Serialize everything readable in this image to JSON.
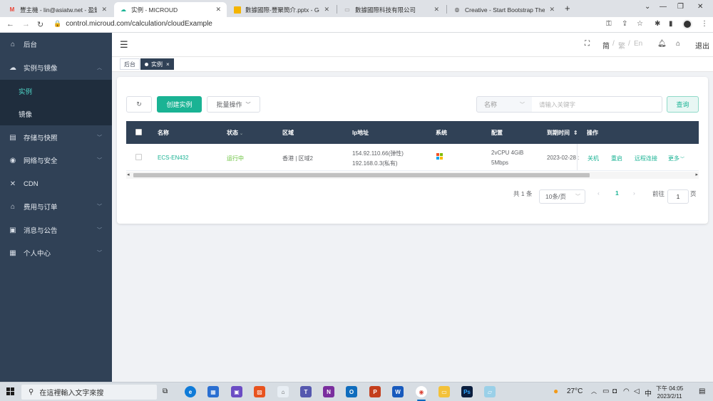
{
  "browser": {
    "tabs": [
      {
        "title": "豐主機 - lin@asiatw.net - 盈欽科",
        "icon": "gmail-icon"
      },
      {
        "title": "实例 - MICROUD",
        "icon": "cloud-icon"
      },
      {
        "title": "數據國際-豐聚簡介.pptx - Goo",
        "icon": "slides-icon"
      },
      {
        "title": "數據國際科技有限公司",
        "icon": "page-icon"
      },
      {
        "title": "Creative - Start Bootstrap Them",
        "icon": "globe-icon"
      }
    ],
    "url": "control.microud.com/calculation/cloudExample"
  },
  "sidebar": {
    "items": [
      {
        "label": "后台",
        "icon": "home-icon"
      },
      {
        "label": "实例与镜像",
        "icon": "cloud-icon"
      },
      {
        "label": "存储与快照",
        "icon": "storage-icon"
      },
      {
        "label": "网络与安全",
        "icon": "network-icon"
      },
      {
        "label": "CDN",
        "icon": "cdn-icon"
      },
      {
        "label": "费用与订单",
        "icon": "home-icon"
      },
      {
        "label": "消息与公告",
        "icon": "message-icon"
      },
      {
        "label": "个人中心",
        "icon": "grid-icon"
      }
    ],
    "submenu": [
      {
        "label": "实例"
      },
      {
        "label": "镜像"
      }
    ]
  },
  "header": {
    "lang_simplified": "简",
    "lang_traditional": "繁",
    "lang_english": "En",
    "logout": "退出",
    "separator": "/"
  },
  "tags": [
    {
      "label": "后台"
    },
    {
      "label": "实例"
    }
  ],
  "toolbar": {
    "create_label": "创建实例",
    "batch_label": "批量操作",
    "filter_field": "名称",
    "keyword_placeholder": "请输入关键字",
    "query_label": "查询"
  },
  "table": {
    "columns": [
      "名称",
      "状态",
      "区域",
      "Ip地址",
      "系统",
      "配置",
      "到期时间",
      "操作"
    ],
    "rows": [
      {
        "name": "ECS-EN432",
        "status": "运行中",
        "region": "香港 | 区域2",
        "ip_public": "154.92.110.66(弹性)",
        "ip_private": "192.168.0.3(私有)",
        "system": "windows-logo",
        "config_line1": "2vCPU 4GiB",
        "config_line2": "5Mbps",
        "expiry": "2023-02-28 :",
        "actions": [
          "关机",
          "重启",
          "远程连接",
          "更多"
        ]
      }
    ]
  },
  "pagination": {
    "total": "共 1 条",
    "page_size": "10条/页",
    "current_page": "1",
    "goto_label": "前往",
    "goto_value": "1",
    "page_unit": "页"
  },
  "taskbar": {
    "search_placeholder": "在這裡輸入文字來搜",
    "weather": "27°C",
    "ime": "中",
    "time": "下午 04:05",
    "date": "2023/2/11"
  },
  "colors": {
    "sidebar_bg": "#304156",
    "sidebar_sub_bg": "#1f2d3d",
    "accent": "#1ab394",
    "running": "#67c23a"
  }
}
